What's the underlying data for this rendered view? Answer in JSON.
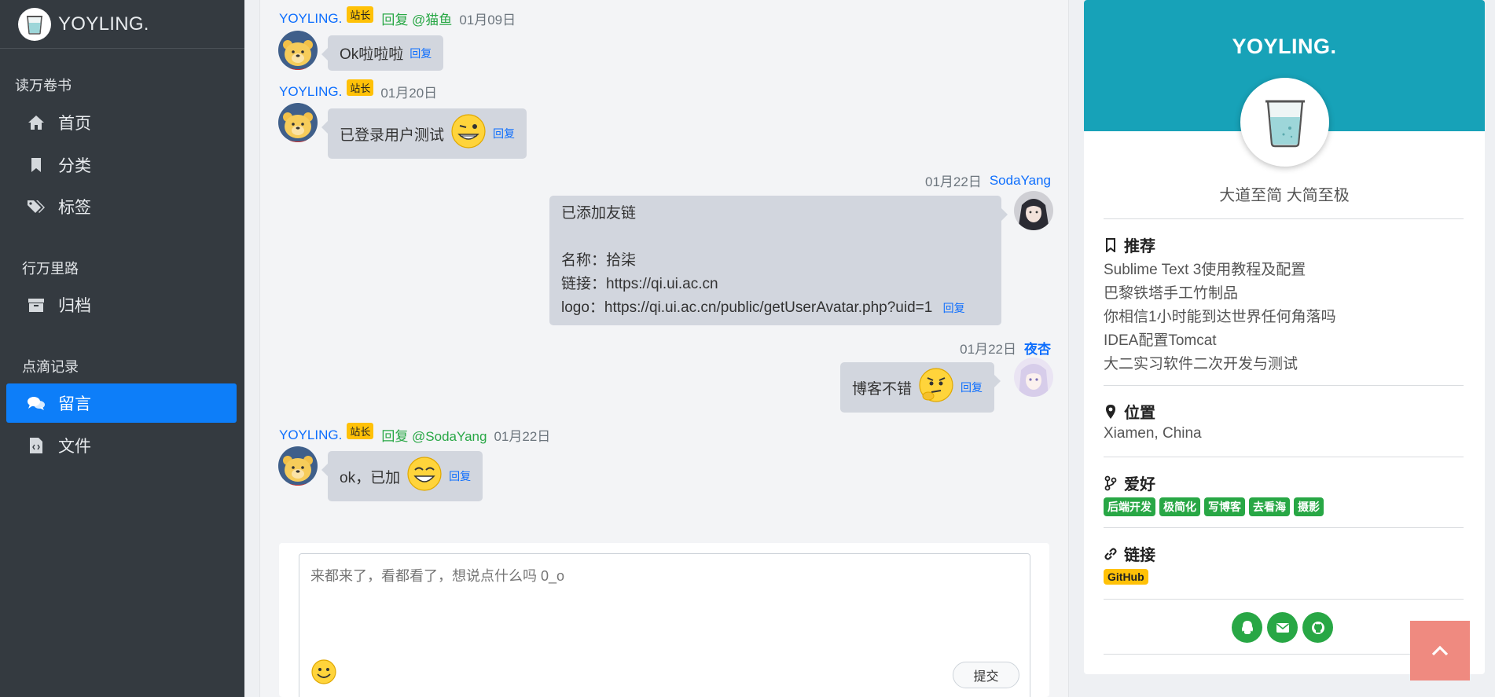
{
  "sidebar": {
    "brand": "YOYLING.",
    "sections": [
      "读万卷书",
      "行万里路",
      "点滴记录"
    ],
    "items": [
      {
        "label": "首页",
        "icon": "home-icon"
      },
      {
        "label": "分类",
        "icon": "bookmark-icon"
      },
      {
        "label": "标签",
        "icon": "tags-icon"
      },
      {
        "label": "归档",
        "icon": "archive-icon"
      },
      {
        "label": "留言",
        "icon": "comments-icon",
        "active": true
      },
      {
        "label": "文件",
        "icon": "file-code-icon"
      }
    ]
  },
  "comments": [
    {
      "author": "YOYLING.",
      "badge": "站长",
      "reply_to": "回复 @猫鱼",
      "date": "01月09日",
      "text": "Ok啦啦啦",
      "reply": "回复"
    },
    {
      "author": "YOYLING.",
      "badge": "站长",
      "date": "01月20日",
      "text": "已登录用户测试",
      "reply": "回复"
    },
    {
      "author": "SodaYang",
      "date": "01月22日",
      "lines": [
        "已添加友链",
        "",
        "名称：拾柒",
        "链接：https://qi.ui.ac.cn",
        "logo：https://qi.ui.ac.cn/public/getUserAvatar.php?uid=1"
      ],
      "reply": "回复"
    },
    {
      "author": "夜杏",
      "date": "01月22日",
      "text": "博客不错",
      "reply": "回复"
    },
    {
      "author": "YOYLING.",
      "badge": "站长",
      "reply_to": "回复 @SodaYang",
      "date": "01月22日",
      "text": "ok，已加",
      "reply": "回复"
    }
  ],
  "form": {
    "placeholder": "来都来了，看都看了，想说点什么吗 0_o",
    "submit": "提交"
  },
  "profile": {
    "title": "YOYLING.",
    "motto": "大道至简 大简至极",
    "recommend_title": "推荐",
    "recommend": [
      "Sublime Text 3使用教程及配置",
      "巴黎铁塔手工竹制品",
      "你相信1小时能到达世界任何角落吗",
      "IDEA配置Tomcat",
      "大二实习软件二次开发与测试"
    ],
    "location_title": "位置",
    "location": "Xiamen, China",
    "hobby_title": "爱好",
    "hobbies": [
      "后端开发",
      "极简化",
      "写博客",
      "去看海",
      "摄影"
    ],
    "links_title": "链接",
    "links": [
      "GitHub"
    ]
  },
  "colors": {
    "sidebar_bg": "#343a40",
    "active": "#0d7ef9",
    "profile_header": "#17a2b8",
    "tag_green": "#28a745",
    "badge_yellow": "#ffc107",
    "back_to_top": "#ef8a80"
  }
}
